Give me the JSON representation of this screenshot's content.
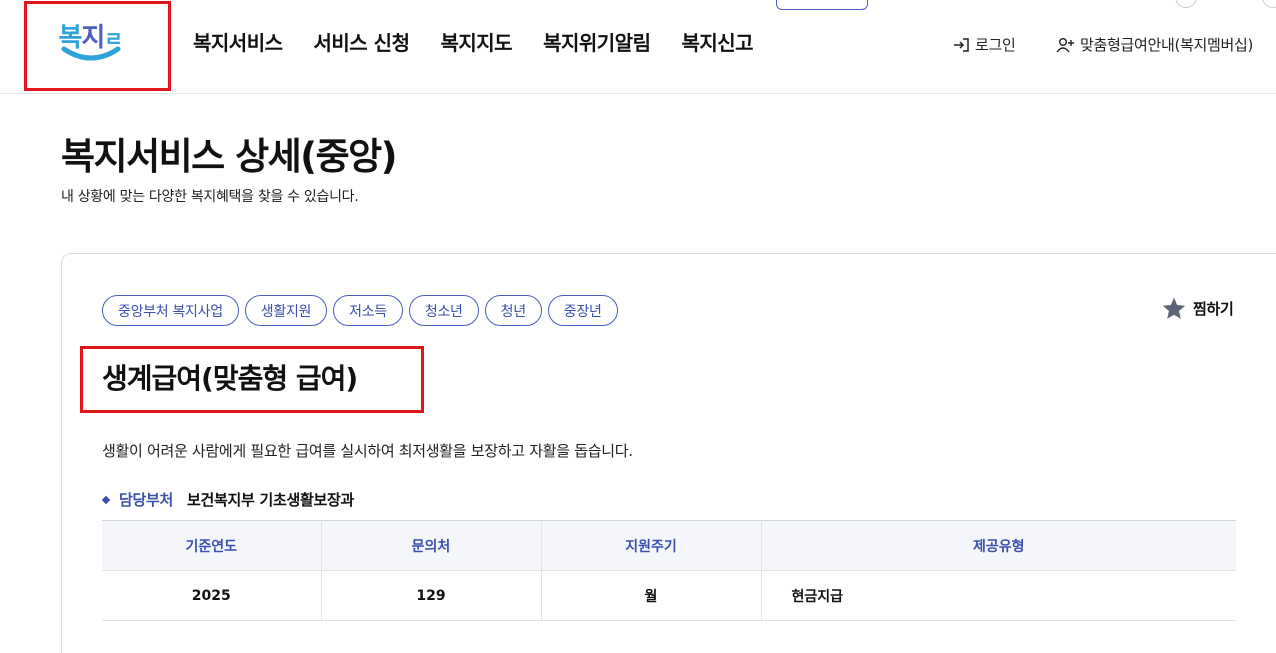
{
  "header": {
    "logo_alt": "복지로",
    "nav": [
      "복지서비스",
      "서비스 신청",
      "복지지도",
      "복지위기알림",
      "복지신고"
    ],
    "login_label": "로그인",
    "member_label": "맞춤형급여안내(복지멤버십)"
  },
  "page": {
    "title": "복지서비스 상세(중앙)",
    "description": "내 상황에 맞는 다양한 복지혜택을 찾을 수 있습니다."
  },
  "service": {
    "tags": [
      "중앙부처 복지사업",
      "생활지원",
      "저소득",
      "청소년",
      "청년",
      "중장년"
    ],
    "bookmark_label": "찜하기",
    "title": "생계급여(맞춤형 급여)",
    "summary": "생활이 어려운 사람에게 필요한 급여를 실시하여 최저생활을 보장하고 자활을 돕습니다.",
    "dept_label": "담당부처",
    "dept_value": "보건복지부 기초생활보장과",
    "table": {
      "headers": [
        "기준연도",
        "문의처",
        "지원주기",
        "제공유형"
      ],
      "row": [
        "2025",
        "129",
        "월",
        "현금지급"
      ]
    }
  },
  "colors": {
    "accent": "#3a4fb0",
    "highlight_box": "#e0161a",
    "logo_blue": "#2fa3d9"
  }
}
